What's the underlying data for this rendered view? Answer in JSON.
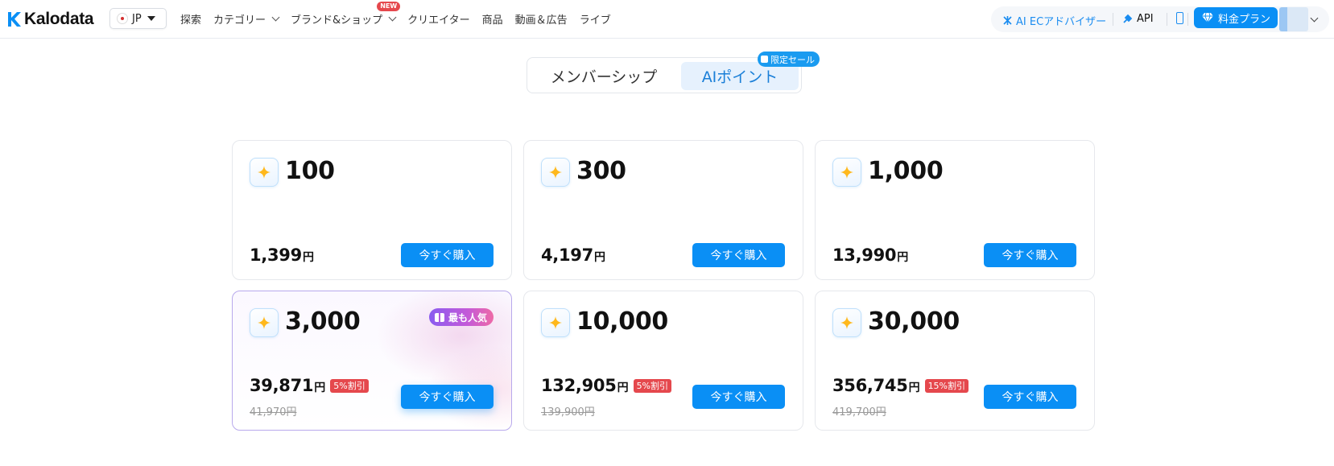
{
  "brand": {
    "name": "Kalodata",
    "color": "#0a8ff5"
  },
  "region": {
    "label": "JP"
  },
  "nav": {
    "items": [
      {
        "label": "探索"
      },
      {
        "label": "カテゴリー"
      },
      {
        "label": "ブランド&ショップ",
        "badge": "NEW"
      },
      {
        "label": "クリエイター"
      },
      {
        "label": "商品"
      },
      {
        "label": "動画＆広告"
      },
      {
        "label": "ライブ"
      }
    ]
  },
  "header_actions": {
    "advisor": "AI ECアドバイザー",
    "api": "API",
    "pricing": "料金プラン"
  },
  "tabs": {
    "membership": "メンバーシップ",
    "ai_points": "AIポイント",
    "active": "ai_points",
    "sale_badge": "限定セール"
  },
  "cards": [
    {
      "points": "100",
      "price": "1,399",
      "currency": "円",
      "buy": "今すぐ購入"
    },
    {
      "points": "300",
      "price": "4,197",
      "currency": "円",
      "buy": "今すぐ購入"
    },
    {
      "points": "1,000",
      "price": "13,990",
      "currency": "円",
      "buy": "今すぐ購入"
    },
    {
      "points": "3,000",
      "price": "39,871",
      "currency": "円",
      "discount": "5%割引",
      "original": "41,970円",
      "badge": "最も人気",
      "buy": "今すぐ購入"
    },
    {
      "points": "10,000",
      "price": "132,905",
      "currency": "円",
      "discount": "5%割引",
      "original": "139,900円",
      "buy": "今すぐ購入"
    },
    {
      "points": "30,000",
      "price": "356,745",
      "currency": "円",
      "discount": "15%割引",
      "original": "419,700円",
      "buy": "今すぐ購入"
    }
  ],
  "colors": {
    "accent": "#0a8ff5",
    "discount": "#e5484d",
    "popular_start": "#8a5cf0",
    "popular_end": "#ee6aa7"
  }
}
